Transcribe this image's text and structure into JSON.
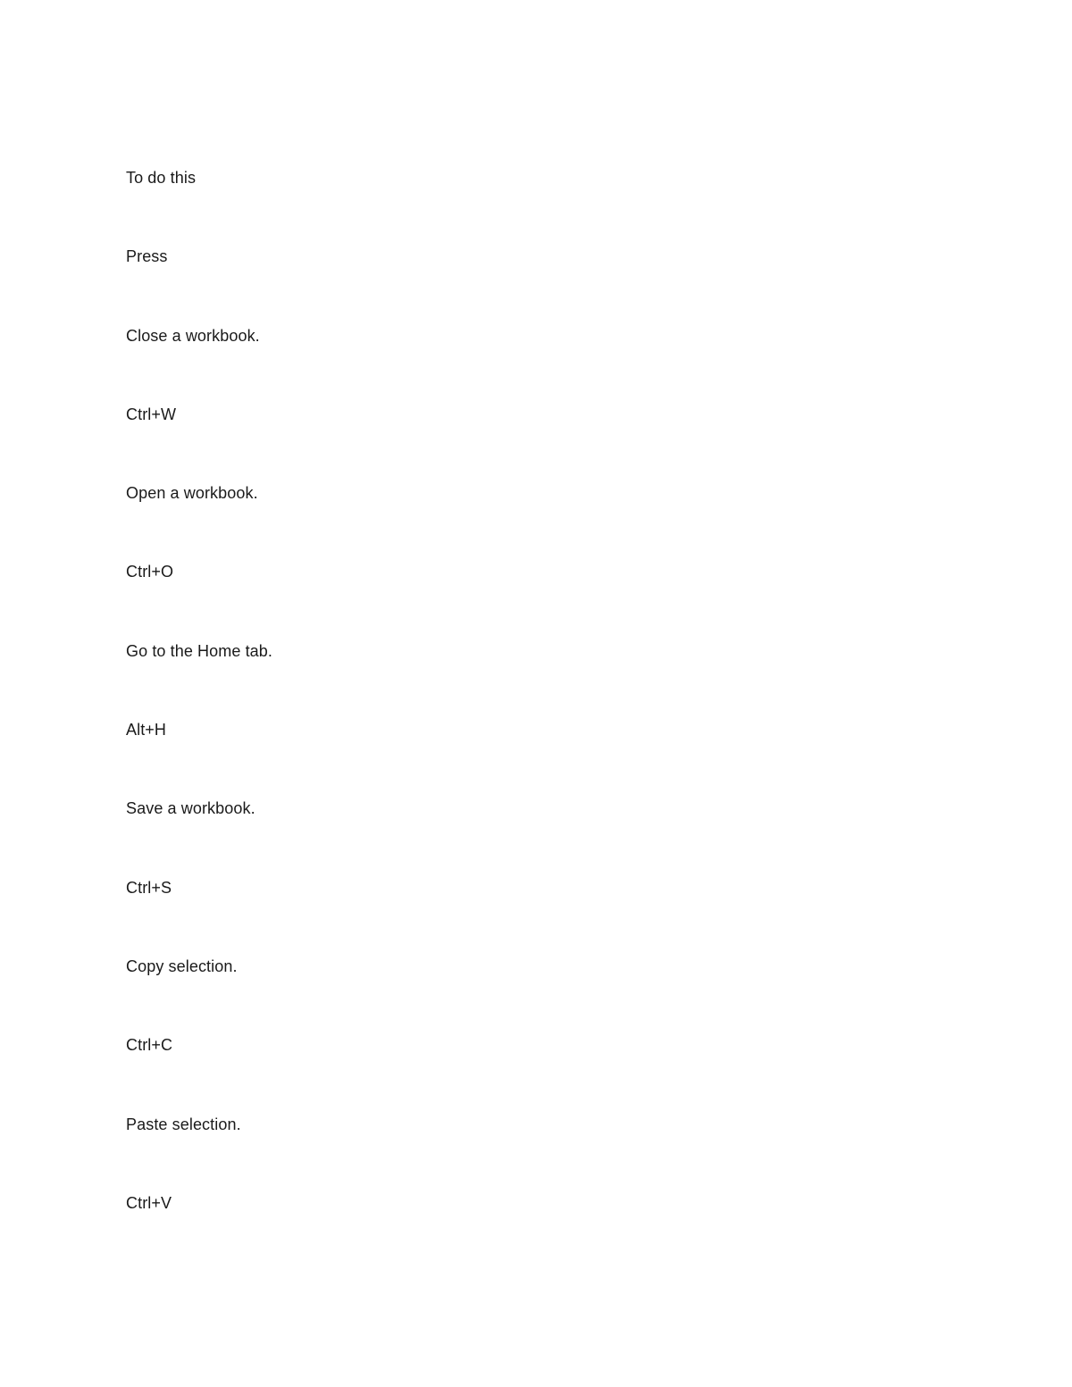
{
  "document": {
    "lines": [
      {
        "role": "header",
        "text": "To do this"
      },
      {
        "role": "header",
        "text": "Press"
      },
      {
        "role": "action",
        "text": "Close a workbook."
      },
      {
        "role": "shortcut",
        "text": "Ctrl+W"
      },
      {
        "role": "action",
        "text": "Open a workbook."
      },
      {
        "role": "shortcut",
        "text": "Ctrl+O"
      },
      {
        "role": "action",
        "text": "Go to the Home tab."
      },
      {
        "role": "shortcut",
        "text": "Alt+H"
      },
      {
        "role": "action",
        "text": "Save a workbook."
      },
      {
        "role": "shortcut",
        "text": "Ctrl+S"
      },
      {
        "role": "action",
        "text": "Copy selection."
      },
      {
        "role": "shortcut",
        "text": "Ctrl+C"
      },
      {
        "role": "action",
        "text": "Paste selection."
      },
      {
        "role": "shortcut",
        "text": "Ctrl+V"
      }
    ]
  }
}
